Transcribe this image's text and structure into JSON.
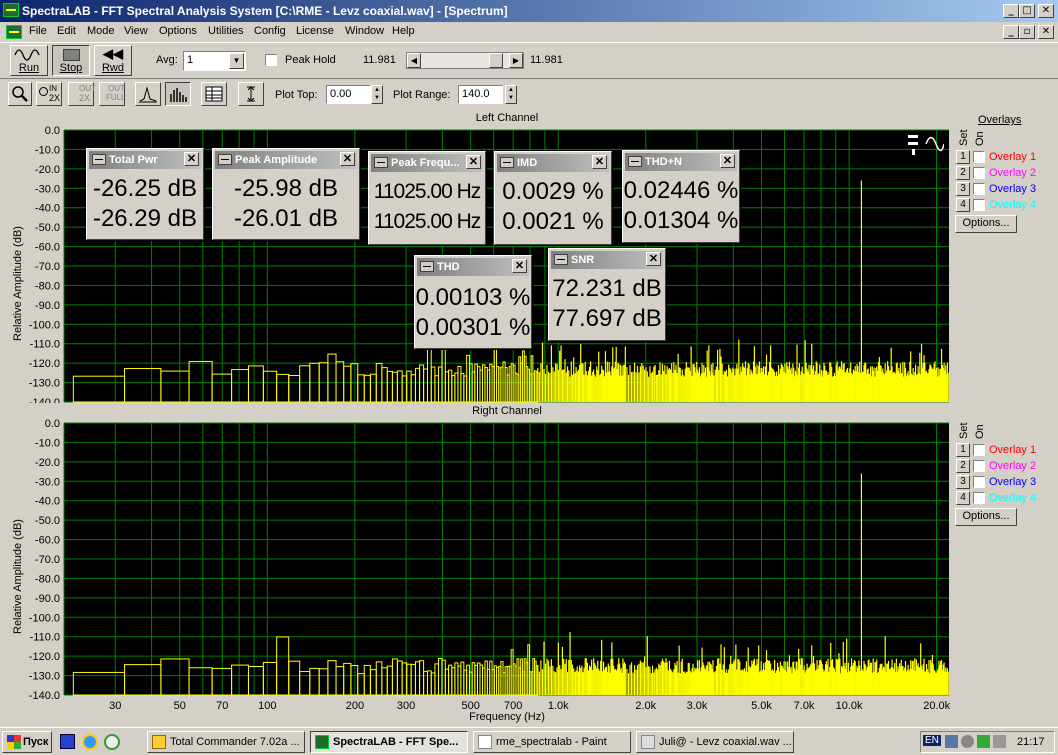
{
  "window": {
    "title": "SpectraLAB - FFT Spectral Analysis System [C:\\RME - Levz coaxial.wav] - [Spectrum]",
    "min": "_",
    "max": "□",
    "close": "✕"
  },
  "menu": [
    "File",
    "Edit",
    "Mode",
    "View",
    "Options",
    "Utilities",
    "Config",
    "License",
    "Window",
    "Help"
  ],
  "toolbar1": {
    "run": "Run",
    "stop": "Stop",
    "rwd": "Rwd",
    "avg_label": "Avg:",
    "avg_value": "1",
    "peak_hold": "Peak Hold",
    "pos_left": "11.981",
    "pos_right": "11.981",
    "pos_fraction": 0.92
  },
  "toolbar2": {
    "zoom_in": "IN",
    "zoom_in_sub": "2X",
    "zoom_out": "OUT",
    "zoom_out_sub": "2X",
    "zoom_full": "OUT",
    "zoom_full_sub": "FULL",
    "plot_top_label": "Plot Top:",
    "plot_top": "0.00",
    "plot_range_label": "Plot Range:",
    "plot_range": "140.0"
  },
  "charts": {
    "ylabel": "Relative Amplitude (dB)",
    "xlabel": "Frequency (Hz)",
    "left_title": "Left Channel",
    "right_title": "Right Channel",
    "overlays_title": "Overlays",
    "set_label": "Set",
    "on_label": "On",
    "options_label": "Options...",
    "overlays": [
      {
        "num": "1",
        "name": "Overlay 1",
        "color": "#ff0000"
      },
      {
        "num": "2",
        "name": "Overlay 2",
        "color": "#ff00ff"
      },
      {
        "num": "3",
        "name": "Overlay 3",
        "color": "#0000ff"
      },
      {
        "num": "4",
        "name": "Overlay 4",
        "color": "#00ffff"
      }
    ],
    "grid_color": "#008000",
    "trace_color": "#ffff00"
  },
  "chart_data": [
    {
      "type": "bar",
      "title": "Left Channel",
      "xlabel": "Frequency (Hz)",
      "ylabel": "Relative Amplitude (dB)",
      "x_scale": "log",
      "xlim": [
        20,
        22050
      ],
      "ylim": [
        -140,
        0
      ],
      "grid": true,
      "yticks": [
        "0.0",
        "-10.0",
        "-20.0",
        "-30.0",
        "-40.0",
        "-50.0",
        "-60.0",
        "-70.0",
        "-80.0",
        "-90.0",
        "-100.0",
        "-110.0",
        "-120.0",
        "-130.0",
        "-140.0"
      ],
      "peak": {
        "x": 11025,
        "y": -26.0
      },
      "noise_floor_db": -123
    },
    {
      "type": "bar",
      "title": "Right Channel",
      "xlabel": "Frequency (Hz)",
      "ylabel": "Relative Amplitude (dB)",
      "x_scale": "log",
      "xlim": [
        20,
        22050
      ],
      "ylim": [
        -140,
        0
      ],
      "grid": true,
      "yticks": [
        "0.0",
        "-10.0",
        "-20.0",
        "-30.0",
        "-40.0",
        "-50.0",
        "-60.0",
        "-70.0",
        "-80.0",
        "-90.0",
        "-100.0",
        "-110.0",
        "-120.0",
        "-130.0",
        "-140.0"
      ],
      "xticks": [
        "30",
        "50",
        "70",
        "100",
        "200",
        "300",
        "500",
        "700",
        "1.0k",
        "2.0k",
        "3.0k",
        "5.0k",
        "7.0k",
        "10.0k",
        "20.0k"
      ],
      "xtick_values": [
        30,
        50,
        70,
        100,
        200,
        300,
        500,
        700,
        1000,
        2000,
        3000,
        5000,
        7000,
        10000,
        20000
      ],
      "peak": {
        "x": 11025,
        "y": -26.0
      },
      "noise_floor_db": -125
    }
  ],
  "metrics": {
    "total_pwr": {
      "title": "Total Pwr",
      "v1": "-26.25 dB",
      "v2": "-26.29 dB"
    },
    "peak_amp": {
      "title": "Peak Amplitude",
      "v1": "-25.98 dB",
      "v2": "-26.01 dB"
    },
    "peak_freq": {
      "title": "Peak Frequ...",
      "v1": "11025.00 Hz",
      "v2": "11025.00 Hz"
    },
    "imd": {
      "title": "IMD",
      "v1": "0.0029 %",
      "v2": "0.0021 %"
    },
    "thdn": {
      "title": "THD+N",
      "v1": "0.02446 %",
      "v2": "0.01304 %"
    },
    "thd": {
      "title": "THD",
      "v1": "0.00103 %",
      "v2": "0.00301 %"
    },
    "snr": {
      "title": "SNR",
      "v1": "72.231 dB",
      "v2": "77.697 dB"
    }
  },
  "taskbar": {
    "start": "Пуск",
    "tasks": [
      "Total Commander 7.02a ...",
      "SpectraLAB - FFT Spe...",
      "rme_spectralab - Paint",
      "Juli@ - Levz coaxial.wav ..."
    ],
    "lang": "EN",
    "clock": "21:17"
  }
}
